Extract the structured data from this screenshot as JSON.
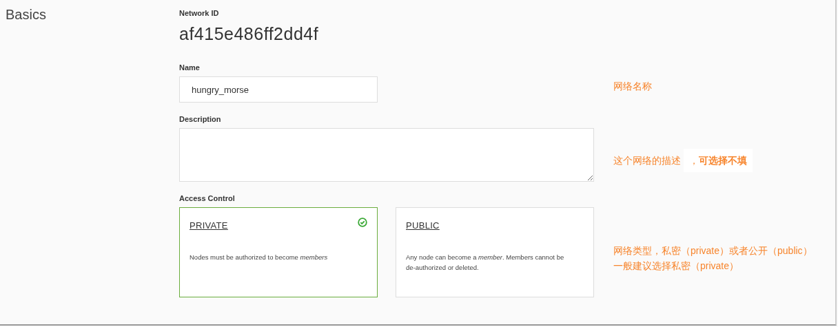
{
  "section": {
    "title": "Basics"
  },
  "network_id": {
    "label": "Network ID",
    "value": "af415e486ff2dd4f"
  },
  "name": {
    "label": "Name",
    "value": "hungry_morse",
    "note": {
      "text": "网络名称"
    }
  },
  "description": {
    "label": "Description",
    "note": {
      "text": "这个网络的描述",
      "highlight": "，**可选择不填**"
    }
  },
  "access_control": {
    "label": "Access Control",
    "options": [
      {
        "title": "PRIVATE",
        "description": "Nodes must be authorized to become *members*",
        "selected": true
      },
      {
        "title": "PUBLIC",
        "description": "Any node can become a *member*. Members cannot be de-authorized or deleted.",
        "selected": false
      }
    ],
    "note": {
      "lines": [
        "网络类型，私密（private）或者公开（public）",
        "一般建议选择私密（private）"
      ]
    }
  }
}
